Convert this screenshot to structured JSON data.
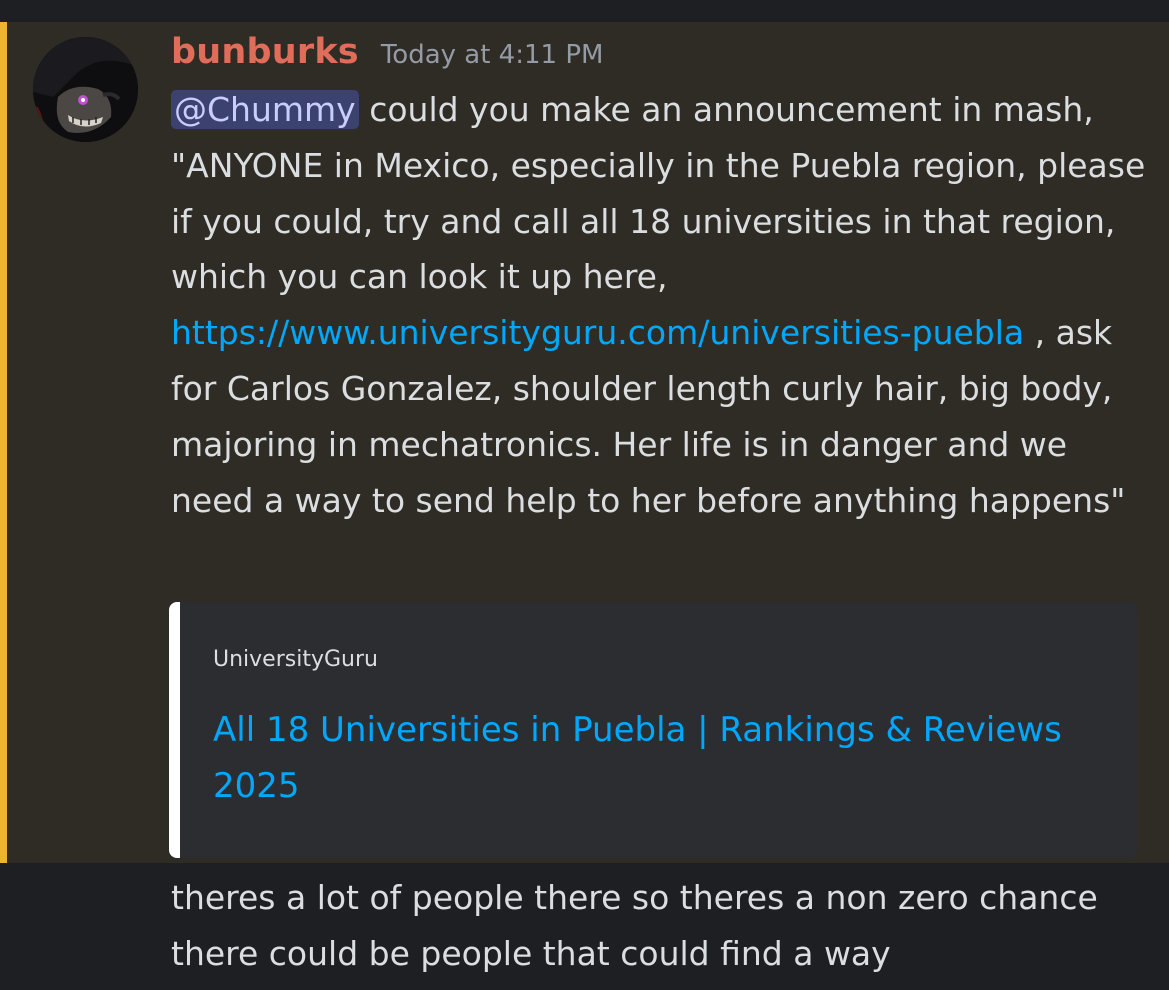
{
  "message": {
    "author": "bunburks",
    "timestamp": "Today at 4:11 PM",
    "mention": "@Chummy",
    "text_before_link": " could you make an announcement in mash, \"ANYONE in Mexico, especially in the Puebla region, please if you could, try and call all 18 universities in that region, which you can look it up here, ",
    "link": "https://www.universityguru.com/universities-puebla",
    "text_after_link": " , ask for Carlos Gonzalez, shoulder length curly hair, big body, majoring in mechatronics. Her life is in danger and we need a way to send help to her before anything happens\""
  },
  "embed": {
    "provider": "UniversityGuru",
    "title": "All 18 Universities in Puebla | Rankings & Reviews 2025"
  },
  "followup": {
    "text": "theres a lot of people there so theres a non zero chance there could be people that could find a way"
  },
  "colors": {
    "mention_bar": "#f0b232",
    "username": "#e06c5a",
    "link": "#00a8fc"
  }
}
